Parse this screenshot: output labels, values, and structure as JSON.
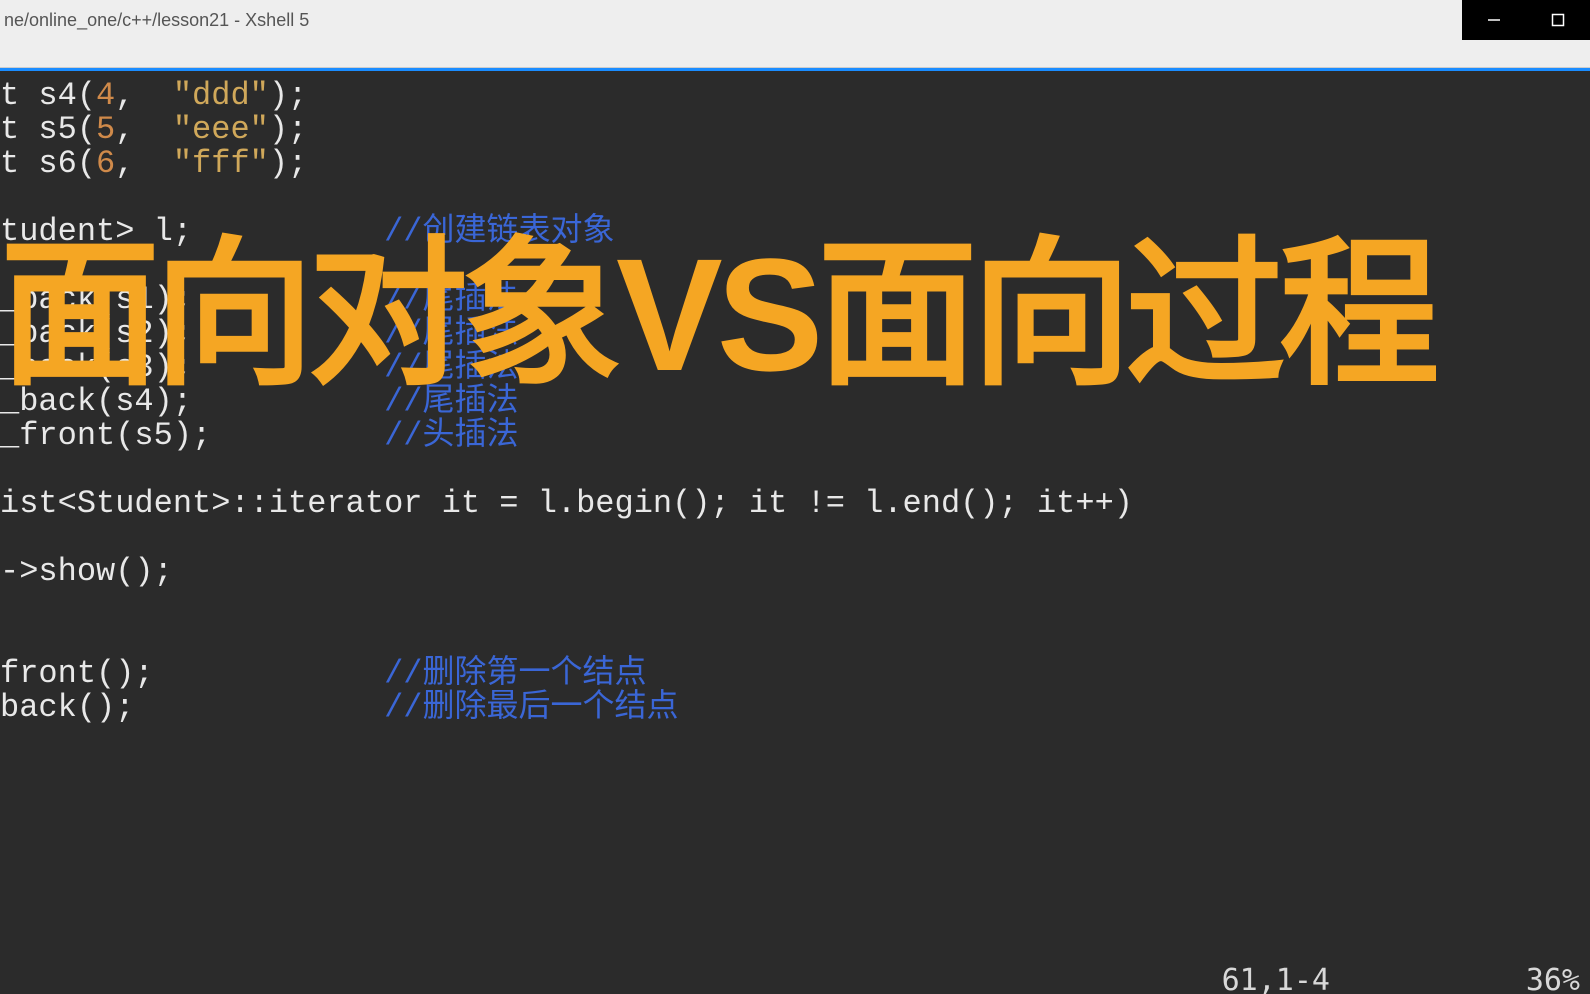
{
  "titlebar": {
    "title": "ne/online_one/c++/lesson21 - Xshell 5"
  },
  "overlay": {
    "text": "面向对象VS面向过程"
  },
  "status": {
    "position": "61,1-4",
    "percent": "36%"
  },
  "code": {
    "l1_a": "t s4(",
    "l1_n": "4",
    "l1_b": ",  ",
    "l1_s": "\"ddd\"",
    "l1_c": ");",
    "l2_a": "t s5(",
    "l2_n": "5",
    "l2_b": ",  ",
    "l2_s": "\"eee\"",
    "l2_c": ");",
    "l3_a": "t s6(",
    "l3_n": "6",
    "l3_b": ",  ",
    "l3_s": "\"fff\"",
    "l3_c": ");",
    "l5_a": "tudent> l;          ",
    "l5_cmt": "//创建链表对象",
    "l7_a": "_back(s1);          ",
    "l7_cmt": "//尾插法",
    "l8_a": "_back(s2);          ",
    "l8_cmt": "//尾插法",
    "l9_a": "_back(s3);          ",
    "l9_cmt": "//尾插法",
    "l10_a": "_back(s4);          ",
    "l10_cmt": "//尾插法",
    "l11_a": "_front(s5);         ",
    "l11_cmt": "//头插法",
    "l13": "ist<Student>::iterator it = l.begin(); it != l.end(); it++)",
    "l15": "->show();",
    "l18_a": "front();            ",
    "l18_cmt": "//删除第一个结点",
    "l19_a": "back();             ",
    "l19_cmt": "//删除最后一个结点"
  }
}
